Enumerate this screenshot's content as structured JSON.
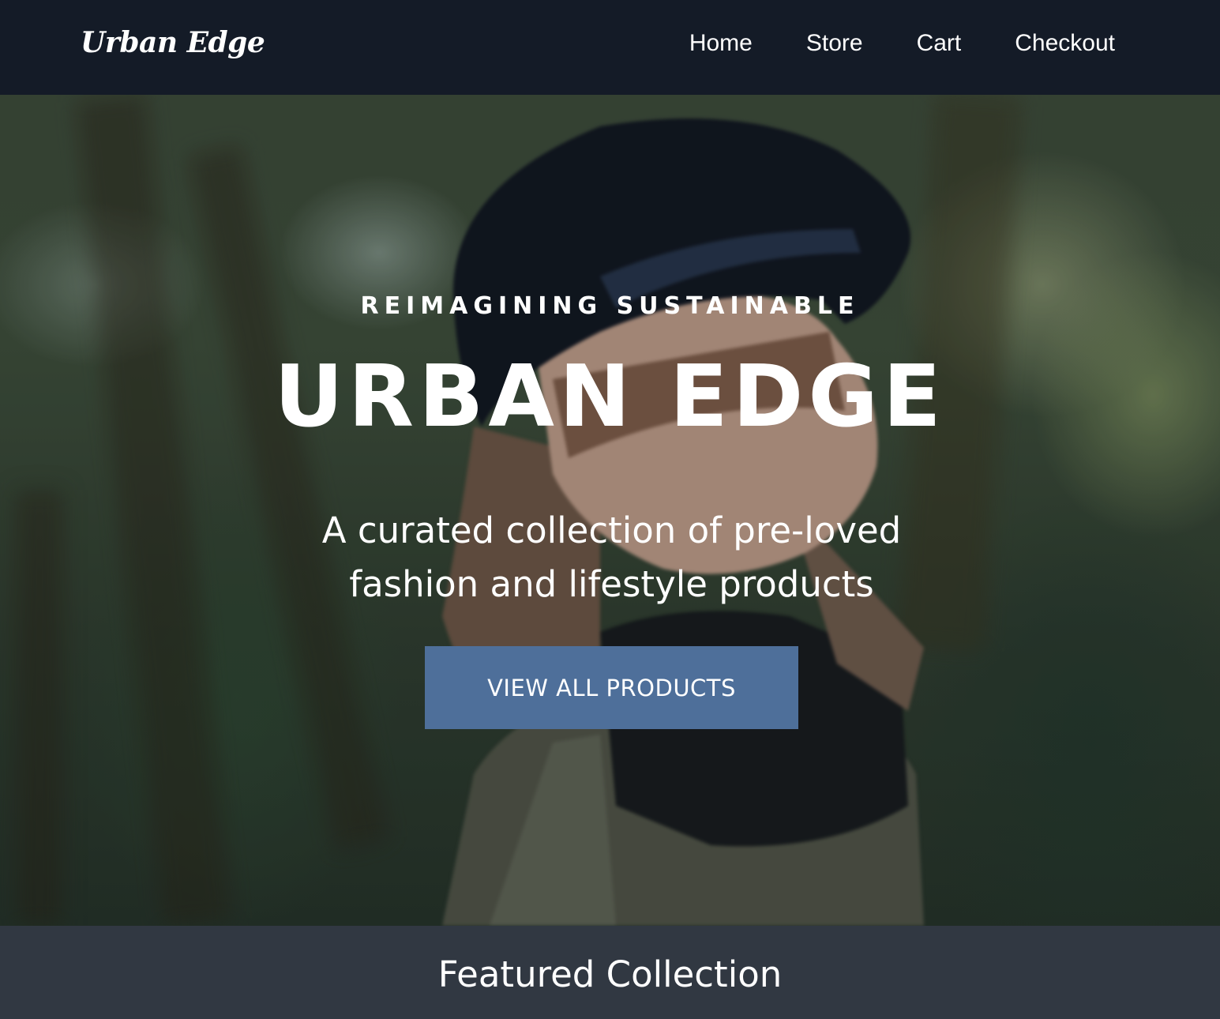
{
  "navbar": {
    "brand": "Urban Edge",
    "links": [
      {
        "label": "Home"
      },
      {
        "label": "Store"
      },
      {
        "label": "Cart"
      },
      {
        "label": "Checkout"
      }
    ]
  },
  "hero": {
    "eyebrow": "REIMAGINING SUSTAINABLE",
    "headline": "URBAN EDGE",
    "tagline": "A curated collection of pre-loved fashion and lifestyle products",
    "cta_label": "VIEW ALL PRODUCTS",
    "background_description_icon": "forest-portrait-image"
  },
  "featured": {
    "title": "Featured Collection"
  },
  "colors": {
    "navbar_bg": "#141b27",
    "cta_bg": "#4e6f9a",
    "featured_bg": "#313842",
    "text": "#ffffff"
  }
}
